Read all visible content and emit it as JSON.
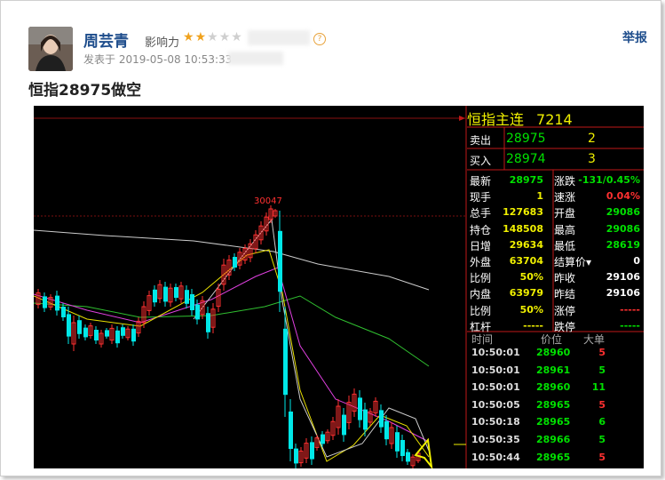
{
  "post": {
    "author": "周芸青",
    "influence_label": "影响力",
    "influence_stars": 2,
    "influence_max": 5,
    "posted_label": "发表于",
    "posted_time": "2019-05-08 10:53:33",
    "report_label": "举报",
    "title": "恒指28975做空"
  },
  "chart_data": {
    "type": "candlestick",
    "peak_label": "30047",
    "panel": {
      "name": "恒指主连",
      "code": "7214",
      "ask": {
        "label": "卖出",
        "price": "28975",
        "volume": "2"
      },
      "bid": {
        "label": "买入",
        "price": "28974",
        "volume": "3"
      },
      "stats": [
        {
          "l1": "最新",
          "v1": "28975",
          "c1": "#00e000",
          "l2": "涨跌",
          "v2": "-131/0.45%",
          "c2": "#00e000"
        },
        {
          "l1": "现手",
          "v1": "1",
          "c1": "#f0f000",
          "l2": "速涨",
          "v2": "0.04%",
          "c2": "#ff3030"
        },
        {
          "l1": "总手",
          "v1": "127683",
          "c1": "#f0f000",
          "l2": "开盘",
          "v2": "29086",
          "c2": "#00e000"
        },
        {
          "l1": "持仓",
          "v1": "148508",
          "c1": "#f0f000",
          "l2": "最高",
          "v2": "29086",
          "c2": "#00e000"
        },
        {
          "l1": "日增",
          "v1": "29634",
          "c1": "#f0f000",
          "l2": "最低",
          "v2": "28619",
          "c2": "#00e000"
        },
        {
          "l1": "外盘",
          "v1": "63704",
          "c1": "#f0f000",
          "l2": "结算价▾",
          "v2": "0",
          "c2": "#ffffff"
        },
        {
          "l1": "比例",
          "v1": "50%",
          "c1": "#f0f000",
          "l2": "昨收",
          "v2": "29106",
          "c2": "#ffffff"
        },
        {
          "l1": "内盘",
          "v1": "63979",
          "c1": "#f0f000",
          "l2": "昨结",
          "v2": "29106",
          "c2": "#ffffff"
        },
        {
          "l1": "比例",
          "v1": "50%",
          "c1": "#f0f000",
          "l2": "涨停",
          "v2": "-----",
          "c2": "#ff3030"
        },
        {
          "l1": "杠杆",
          "v1": "-----",
          "c1": "#f0f000",
          "l2": "跌停",
          "v2": "-----",
          "c2": "#00e000"
        }
      ],
      "ticks_header": {
        "time": "时间",
        "price": "价位",
        "volume": "大单"
      },
      "ticks": [
        {
          "time": "10:50:01",
          "price": "28960",
          "volume": "5",
          "color": "#ff3030"
        },
        {
          "time": "10:50:01",
          "price": "28961",
          "volume": "5",
          "color": "#00e000"
        },
        {
          "time": "10:50:01",
          "price": "28960",
          "volume": "11",
          "color": "#00e000"
        },
        {
          "time": "10:50:05",
          "price": "28965",
          "volume": "5",
          "color": "#ff3030"
        },
        {
          "time": "10:50:18",
          "price": "28965",
          "volume": "6",
          "color": "#00e000"
        },
        {
          "time": "10:50:35",
          "price": "28966",
          "volume": "5",
          "color": "#00e000"
        },
        {
          "time": "10:50:44",
          "price": "28965",
          "volume": "5",
          "color": "#ff3030"
        }
      ]
    },
    "colors": {
      "up": "#ff3030",
      "down": "#00e8e8",
      "ma_white": "#cccccc",
      "ma_yellow": "#e8e000",
      "ma_magenta": "#e040e0",
      "ma_green": "#30c030"
    }
  }
}
